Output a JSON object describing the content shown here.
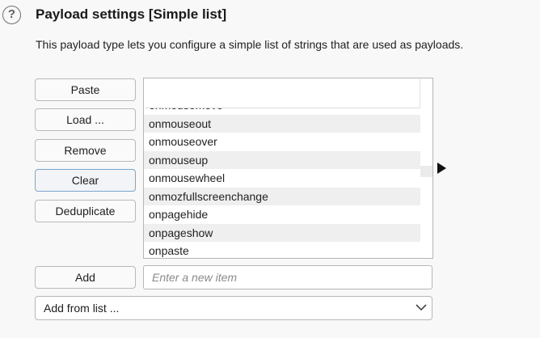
{
  "header": {
    "help_icon_glyph": "?",
    "title": "Payload settings [Simple list]",
    "description": "This payload type lets you configure a simple list of strings that are used as payloads."
  },
  "buttons": {
    "paste": "Paste",
    "load": "Load ...",
    "remove": "Remove",
    "clear": "Clear",
    "deduplicate": "Deduplicate",
    "add": "Add"
  },
  "payload_list": {
    "items": [
      "onmousemove",
      "onmouseout",
      "onmouseover",
      "onmouseup",
      "onmousewheel",
      "onmozfullscreenchange",
      "onpagehide",
      "onpageshow",
      "onpaste"
    ]
  },
  "new_item": {
    "placeholder": "Enter a new item",
    "value": ""
  },
  "add_from_list": {
    "selected": "Add from list ..."
  },
  "colors": {
    "focus_border": "#7aa6cf",
    "row_alt": "#efefef",
    "border": "#b6b6b6"
  }
}
